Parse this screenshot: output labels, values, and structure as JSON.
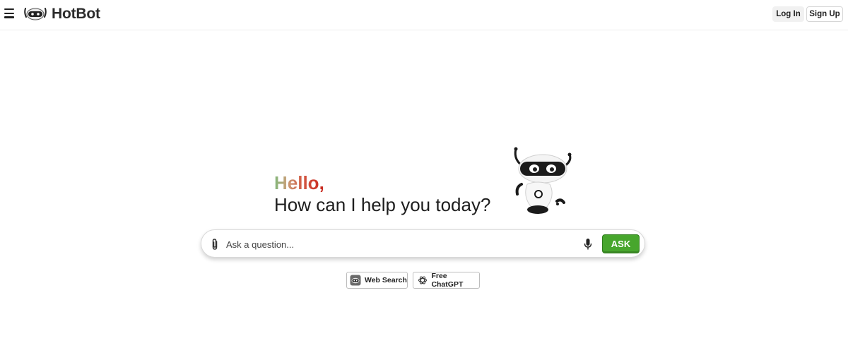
{
  "header": {
    "menu_icon": "hamburger-menu-icon",
    "logo_icon": "robot-head-logo-icon",
    "logo_text": "HotBot",
    "login_label": "Log In",
    "signup_label": "Sign Up"
  },
  "hero": {
    "hello": "Hello,",
    "subtitle": "How can I help you today?",
    "mascot": "robot-mascot-icon"
  },
  "search": {
    "placeholder": "Ask a question...",
    "value": "",
    "attach_icon": "paperclip-icon",
    "mic_icon": "microphone-icon",
    "ask_label": "ASK"
  },
  "modes": [
    {
      "label": "Web Search",
      "icon": "robot-head-icon"
    },
    {
      "label": "Free ChatGPT",
      "icon": "openai-logo-icon"
    }
  ],
  "colors": {
    "ask_green": "#47a62d",
    "hello_start": "#7fb87a",
    "hello_end": "#c8241b",
    "text": "#1e1e1e"
  }
}
